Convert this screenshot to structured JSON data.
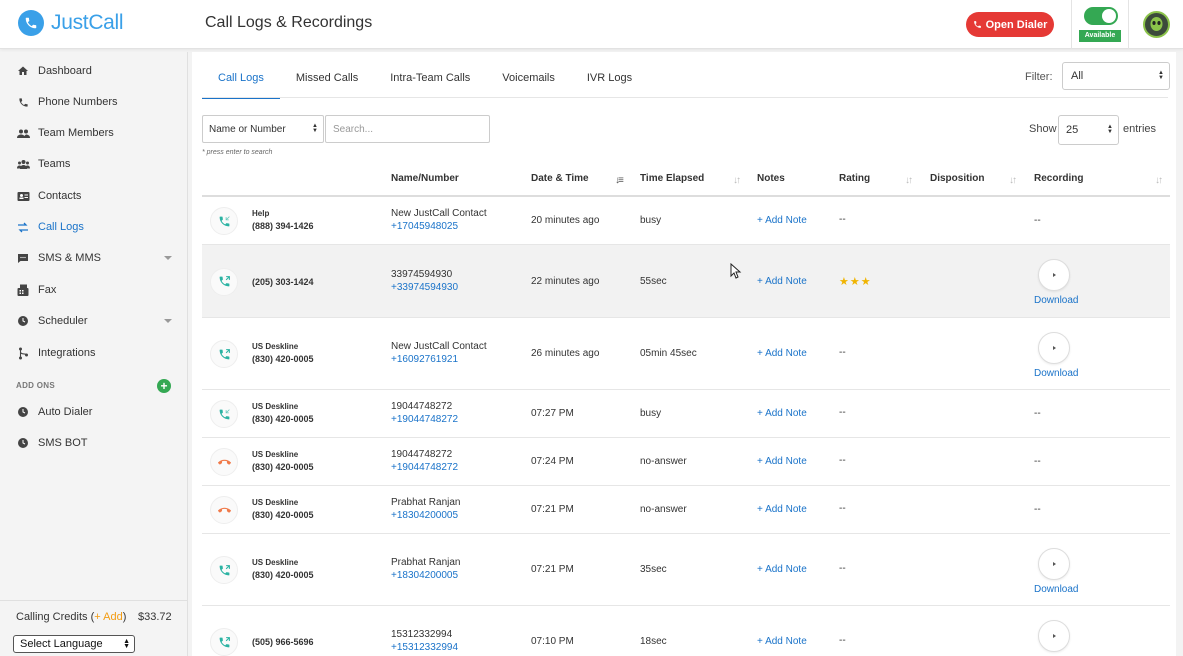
{
  "brand": {
    "name": "JustCall",
    "color": "#3aa0e8"
  },
  "header": {
    "title": "Call Logs & Recordings",
    "open_dialer": "Open Dialer",
    "status_label": "Available"
  },
  "sidebar": {
    "items": [
      {
        "label": "Dashboard",
        "icon": "home-icon"
      },
      {
        "label": "Phone Numbers",
        "icon": "phone-icon"
      },
      {
        "label": "Team Members",
        "icon": "users-icon"
      },
      {
        "label": "Teams",
        "icon": "group-icon"
      },
      {
        "label": "Contacts",
        "icon": "contact-card-icon"
      },
      {
        "label": "Call Logs",
        "icon": "swap-arrows-icon"
      },
      {
        "label": "SMS & MMS",
        "icon": "chat-icon"
      },
      {
        "label": "Fax",
        "icon": "fax-icon"
      },
      {
        "label": "Scheduler",
        "icon": "clock-icon"
      },
      {
        "label": "Integrations",
        "icon": "integration-icon"
      }
    ],
    "addons_label": "ADD ONS",
    "addons": [
      {
        "label": "Auto Dialer",
        "icon": "dialer-icon"
      },
      {
        "label": "SMS BOT",
        "icon": "bot-icon"
      }
    ],
    "credits_label": "Calling Credits (",
    "credits_add": "+ Add",
    "credits_close": ")",
    "credits_amount": "$33.72",
    "language": "Select Language"
  },
  "tabs": [
    "Call Logs",
    "Missed Calls",
    "Intra-Team Calls",
    "Voicemails",
    "IVR Logs"
  ],
  "filter": {
    "label": "Filter:",
    "value": "All"
  },
  "search": {
    "type": "Name or Number",
    "placeholder": "Search...",
    "hint": "* press enter to search"
  },
  "show": {
    "label": "Show",
    "value": "25",
    "suffix": "entries"
  },
  "columns": [
    "Name/Number",
    "Date & Time",
    "Time Elapsed",
    "Notes",
    "Rating",
    "Disposition",
    "Recording"
  ],
  "rows": [
    {
      "caller_name": "Help",
      "caller_num": "(888) 394-1426",
      "name": "New JustCall Contact",
      "number": "+17045948025",
      "datetime": "20 minutes ago",
      "elapsed": "busy",
      "notes": "+ Add Note",
      "rating": "--",
      "recording": "--",
      "call_type": "incoming",
      "has_recording": false
    },
    {
      "caller_name": "",
      "caller_num": "(205) 303-1424",
      "name": "33974594930",
      "number": "+33974594930",
      "datetime": "22 minutes ago",
      "elapsed": "55sec",
      "notes": "+ Add Note",
      "rating": "★★★",
      "recording": "Download",
      "call_type": "outgoing",
      "has_recording": true
    },
    {
      "caller_name": "US Deskline",
      "caller_num": "(830) 420-0005",
      "name": "New JustCall Contact",
      "number": "+16092761921",
      "datetime": "26 minutes ago",
      "elapsed": "05min 45sec",
      "notes": "+ Add Note",
      "rating": "--",
      "recording": "Download",
      "call_type": "outgoing",
      "has_recording": true
    },
    {
      "caller_name": "US Deskline",
      "caller_num": "(830) 420-0005",
      "name": "19044748272",
      "number": "+19044748272",
      "datetime": "07:27 PM",
      "elapsed": "busy",
      "notes": "+ Add Note",
      "rating": "--",
      "recording": "--",
      "call_type": "incoming",
      "has_recording": false
    },
    {
      "caller_name": "US Deskline",
      "caller_num": "(830) 420-0005",
      "name": "19044748272",
      "number": "+19044748272",
      "datetime": "07:24 PM",
      "elapsed": "no-answer",
      "notes": "+ Add Note",
      "rating": "--",
      "recording": "--",
      "call_type": "missed",
      "has_recording": false
    },
    {
      "caller_name": "US Deskline",
      "caller_num": "(830) 420-0005",
      "name": "Prabhat Ranjan",
      "number": "+18304200005",
      "datetime": "07:21 PM",
      "elapsed": "no-answer",
      "notes": "+ Add Note",
      "rating": "--",
      "recording": "--",
      "call_type": "missed",
      "has_recording": false
    },
    {
      "caller_name": "US Deskline",
      "caller_num": "(830) 420-0005",
      "name": "Prabhat Ranjan",
      "number": "+18304200005",
      "datetime": "07:21 PM",
      "elapsed": "35sec",
      "notes": "+ Add Note",
      "rating": "--",
      "recording": "Download",
      "call_type": "outgoing",
      "has_recording": true
    },
    {
      "caller_name": "",
      "caller_num": "(505) 966-5696",
      "name": "15312332994",
      "number": "+15312332994",
      "datetime": "07:10 PM",
      "elapsed": "18sec",
      "notes": "+ Add Note",
      "rating": "--",
      "recording": "",
      "call_type": "outgoing",
      "has_recording": true
    }
  ],
  "colors": {
    "accent": "#1a73c9",
    "danger": "#e53935",
    "success": "#34a853",
    "star": "#f0b400",
    "incoming": "#2bb3a3",
    "missed": "#f07a4a"
  }
}
